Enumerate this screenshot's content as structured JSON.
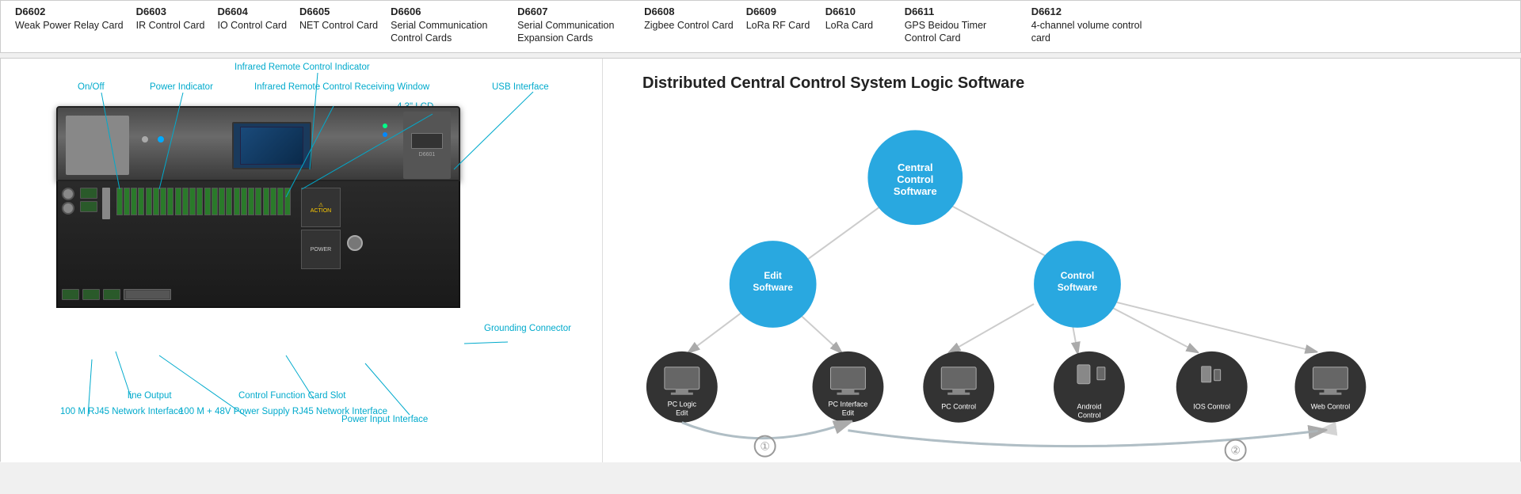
{
  "top_table": {
    "cells": [
      {
        "code": "D6602",
        "name": "Weak Power Relay Card"
      },
      {
        "code": "D6603",
        "name": "IR Control Card"
      },
      {
        "code": "D6604",
        "name": "IO Control Card"
      },
      {
        "code": "D6605",
        "name": "NET Control Card"
      },
      {
        "code": "D6606",
        "name": "Serial Communication Control Cards"
      },
      {
        "code": "D6607",
        "name": "Serial Communication Expansion Cards"
      },
      {
        "code": "D6608",
        "name": "Zigbee Control Card"
      },
      {
        "code": "D6609",
        "name": "LoRa RF Card"
      },
      {
        "code": "D6610",
        "name": "LoRa Card"
      },
      {
        "code": "D6611",
        "name": "GPS Beidou Timer Control Card"
      },
      {
        "code": "D6612",
        "name": "4-channel volume control card"
      }
    ]
  },
  "labels": {
    "on_off": "On/Off",
    "power_indicator": "Power Indicator",
    "infrared_indicator": "Infrared Remote Control Indicator",
    "infrared_window": "Infrared Remote Control Receiving Window",
    "lcd": "4.3\" LCD",
    "usb": "USB Interface",
    "grounding": "Grounding Connector",
    "line_output": "line Output",
    "network_100m": "100 M RJ45 Network Interface",
    "network_100m_48v": "100 M + 48V Power Supply RJ45 Network Interface",
    "control_card_slot": "Control Function Card Slot",
    "power_input": "Power Input Interface"
  },
  "right_diagram": {
    "title": "Distributed Central Control System Logic Software",
    "central_control": "Central Control Software",
    "edit_software": "Edit Software",
    "control_software": "Control Software",
    "nodes": [
      {
        "label": "PC Logic\nEdit"
      },
      {
        "label": "PC Interface\nEdit"
      },
      {
        "label": "PC Control"
      },
      {
        "label": "Android\nControl"
      },
      {
        "label": "IOS Control"
      },
      {
        "label": "Web Control"
      }
    ],
    "num1": "①",
    "num2": "②"
  }
}
